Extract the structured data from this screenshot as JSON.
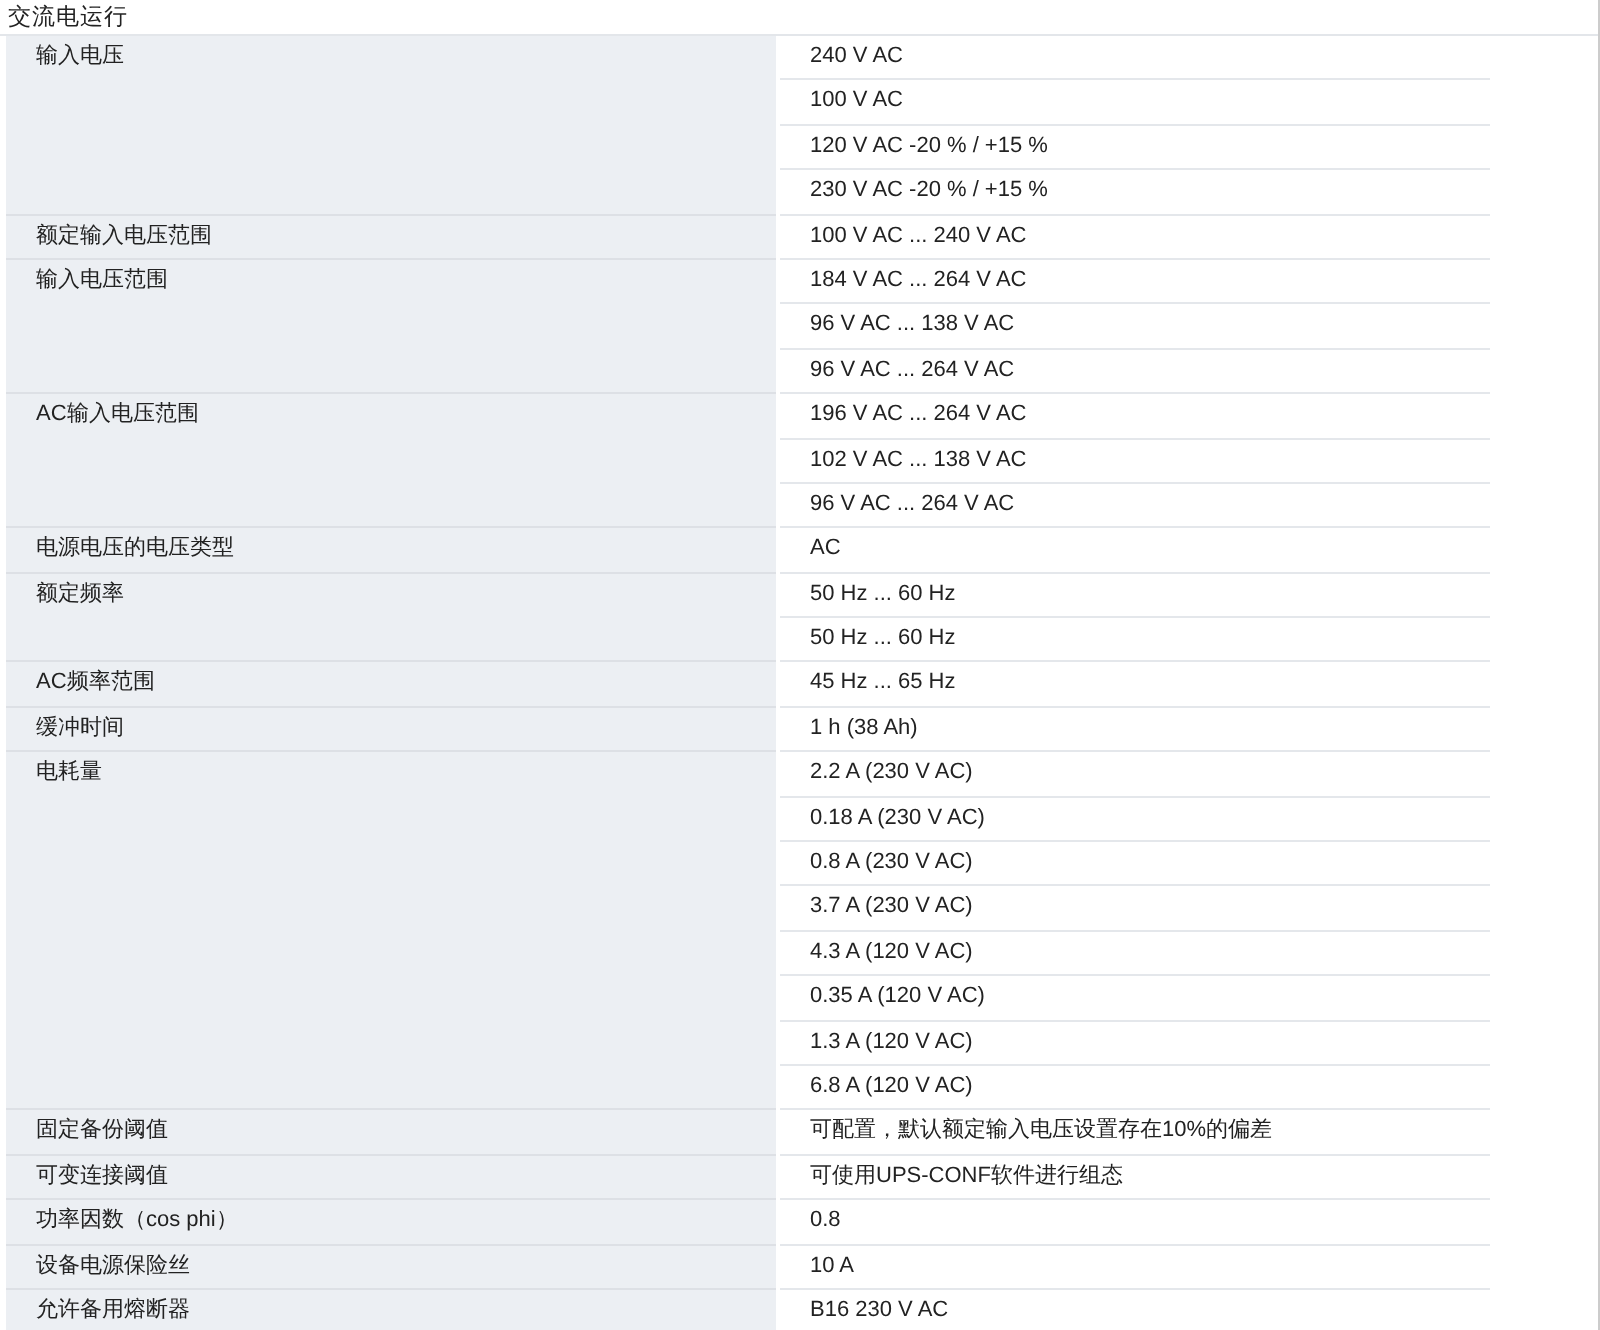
{
  "section_title": "交流电运行",
  "groups": [
    {
      "label": "输入电压",
      "values": [
        "240 V AC",
        "100 V AC",
        "120 V AC -20 % / +15 %",
        "230 V AC -20 % / +15 %"
      ]
    },
    {
      "label": "额定输入电压范围",
      "values": [
        "100 V AC ... 240 V AC"
      ]
    },
    {
      "label": "输入电压范围",
      "values": [
        "184 V AC ... 264 V AC",
        "96 V AC ... 138 V AC",
        "96 V AC ... 264 V AC"
      ]
    },
    {
      "label": "AC输入电压范围",
      "values": [
        "196 V AC ... 264 V AC",
        "102 V AC ... 138 V AC",
        "96 V AC ... 264 V AC"
      ]
    },
    {
      "label": "电源电压的电压类型",
      "values": [
        "AC"
      ]
    },
    {
      "label": "额定频率",
      "values": [
        "50 Hz ... 60 Hz",
        "50 Hz ... 60 Hz"
      ]
    },
    {
      "label": "AC频率范围",
      "values": [
        "45 Hz ... 65 Hz"
      ]
    },
    {
      "label": "缓冲时间",
      "values": [
        "1 h (38 Ah)"
      ]
    },
    {
      "label": "电耗量",
      "values": [
        "2.2 A (230 V AC)",
        "0.18 A (230 V AC)",
        "0.8 A (230 V AC)",
        "3.7 A (230 V AC)",
        "4.3 A (120 V AC)",
        "0.35 A (120 V AC)",
        "1.3 A (120 V AC)",
        "6.8 A (120 V AC)"
      ]
    },
    {
      "label": "固定备份阈值",
      "values": [
        "可配置，默认额定输入电压设置存在10%的偏差"
      ]
    },
    {
      "label": "可变连接阈值",
      "values": [
        "可使用UPS-CONF软件进行组态"
      ]
    },
    {
      "label": "功率因数（cos phi）",
      "values": [
        "0.8"
      ]
    },
    {
      "label": "设备电源保险丝",
      "values": [
        "10 A"
      ]
    },
    {
      "label": "允许备用熔断器",
      "values": [
        "B16 230 V AC"
      ]
    }
  ]
}
